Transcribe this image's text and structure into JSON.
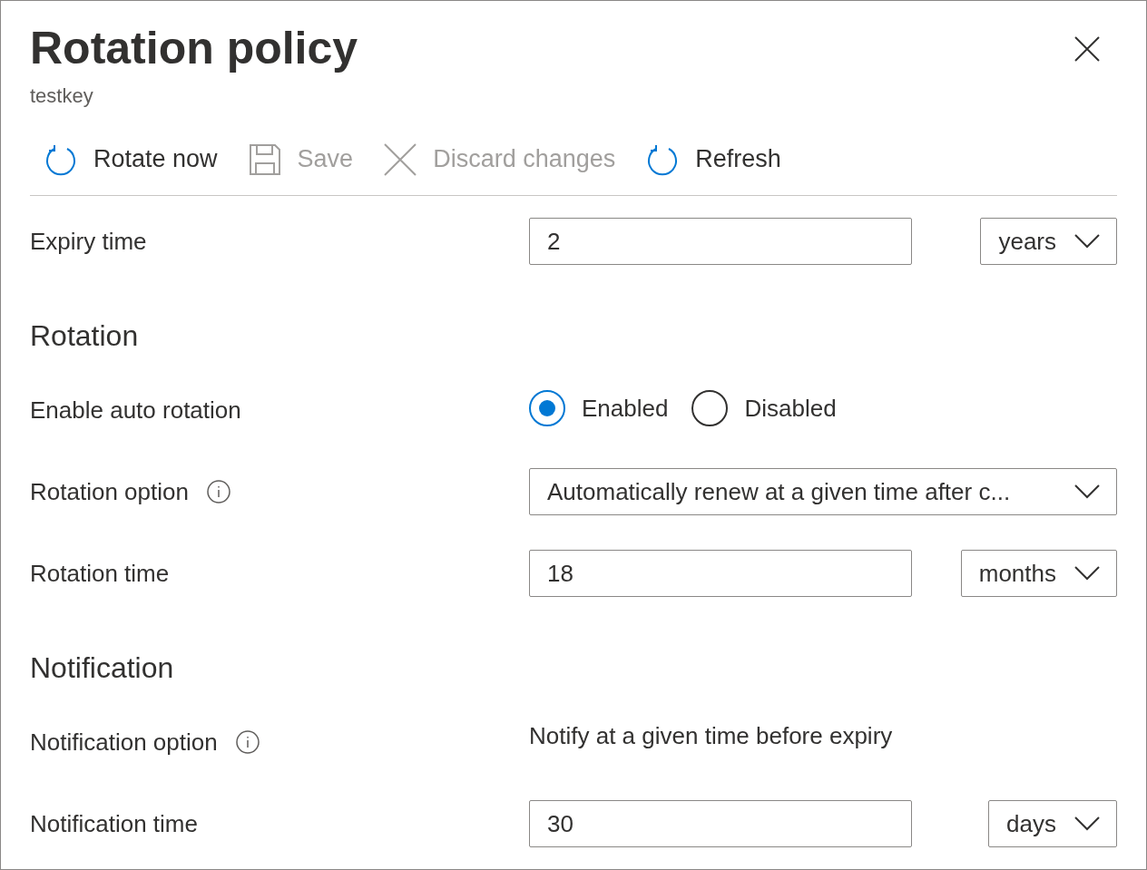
{
  "panel": {
    "title": "Rotation policy",
    "subtitle": "testkey"
  },
  "toolbar": [
    {
      "label": "Rotate now",
      "kind": "rotate",
      "disabled": false
    },
    {
      "label": "Save",
      "kind": "save",
      "disabled": true
    },
    {
      "label": "Discard changes",
      "kind": "discard",
      "disabled": true
    },
    {
      "label": "Refresh",
      "kind": "rotate",
      "disabled": false
    }
  ],
  "rows": [
    {
      "kind": "field",
      "label": "Expiry time",
      "value": "2",
      "unit": "years"
    },
    {
      "kind": "heading",
      "label": "Rotation"
    },
    {
      "kind": "radio",
      "label": "Enable auto rotation",
      "options": [
        {
          "label": "Enabled",
          "selected": true
        },
        {
          "label": "Disabled",
          "selected": false
        }
      ]
    },
    {
      "kind": "select",
      "label": "Rotation option",
      "info": true,
      "value": "Automatically renew at a given time after c..."
    },
    {
      "kind": "field",
      "label": "Rotation time",
      "value": "18",
      "unit": "months"
    },
    {
      "kind": "heading",
      "label": "Notification"
    },
    {
      "kind": "text",
      "label": "Notification option",
      "info": true,
      "value": "Notify at a given time before expiry"
    },
    {
      "kind": "field",
      "label": "Notification time",
      "value": "30",
      "unit": "days"
    }
  ]
}
